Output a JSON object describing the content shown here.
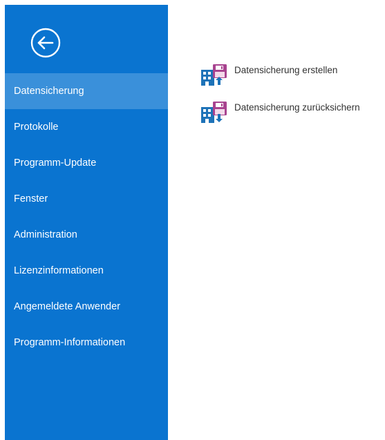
{
  "sidebar": {
    "back_icon": "back-arrow-circle-icon",
    "items": [
      {
        "label": "Datensicherung",
        "active": true
      },
      {
        "label": "Protokolle",
        "active": false
      },
      {
        "label": "Programm-Update",
        "active": false
      },
      {
        "label": "Fenster",
        "active": false
      },
      {
        "label": "Administration",
        "active": false
      },
      {
        "label": "Lizenzinformationen",
        "active": false
      },
      {
        "label": "Angemeldete Anwender",
        "active": false
      },
      {
        "label": "Programm-Informationen",
        "active": false
      }
    ]
  },
  "main": {
    "actions": [
      {
        "label": "Datensicherung erstellen",
        "icon": "backup-create-icon"
      },
      {
        "label": "Datensicherung zurücksichern",
        "icon": "backup-restore-icon"
      }
    ]
  },
  "colors": {
    "sidebar_bg": "#0a74d0",
    "active_item_bg": "#3a90da",
    "icon_building": "#1e73b8",
    "icon_floppy": "#a8438f"
  }
}
